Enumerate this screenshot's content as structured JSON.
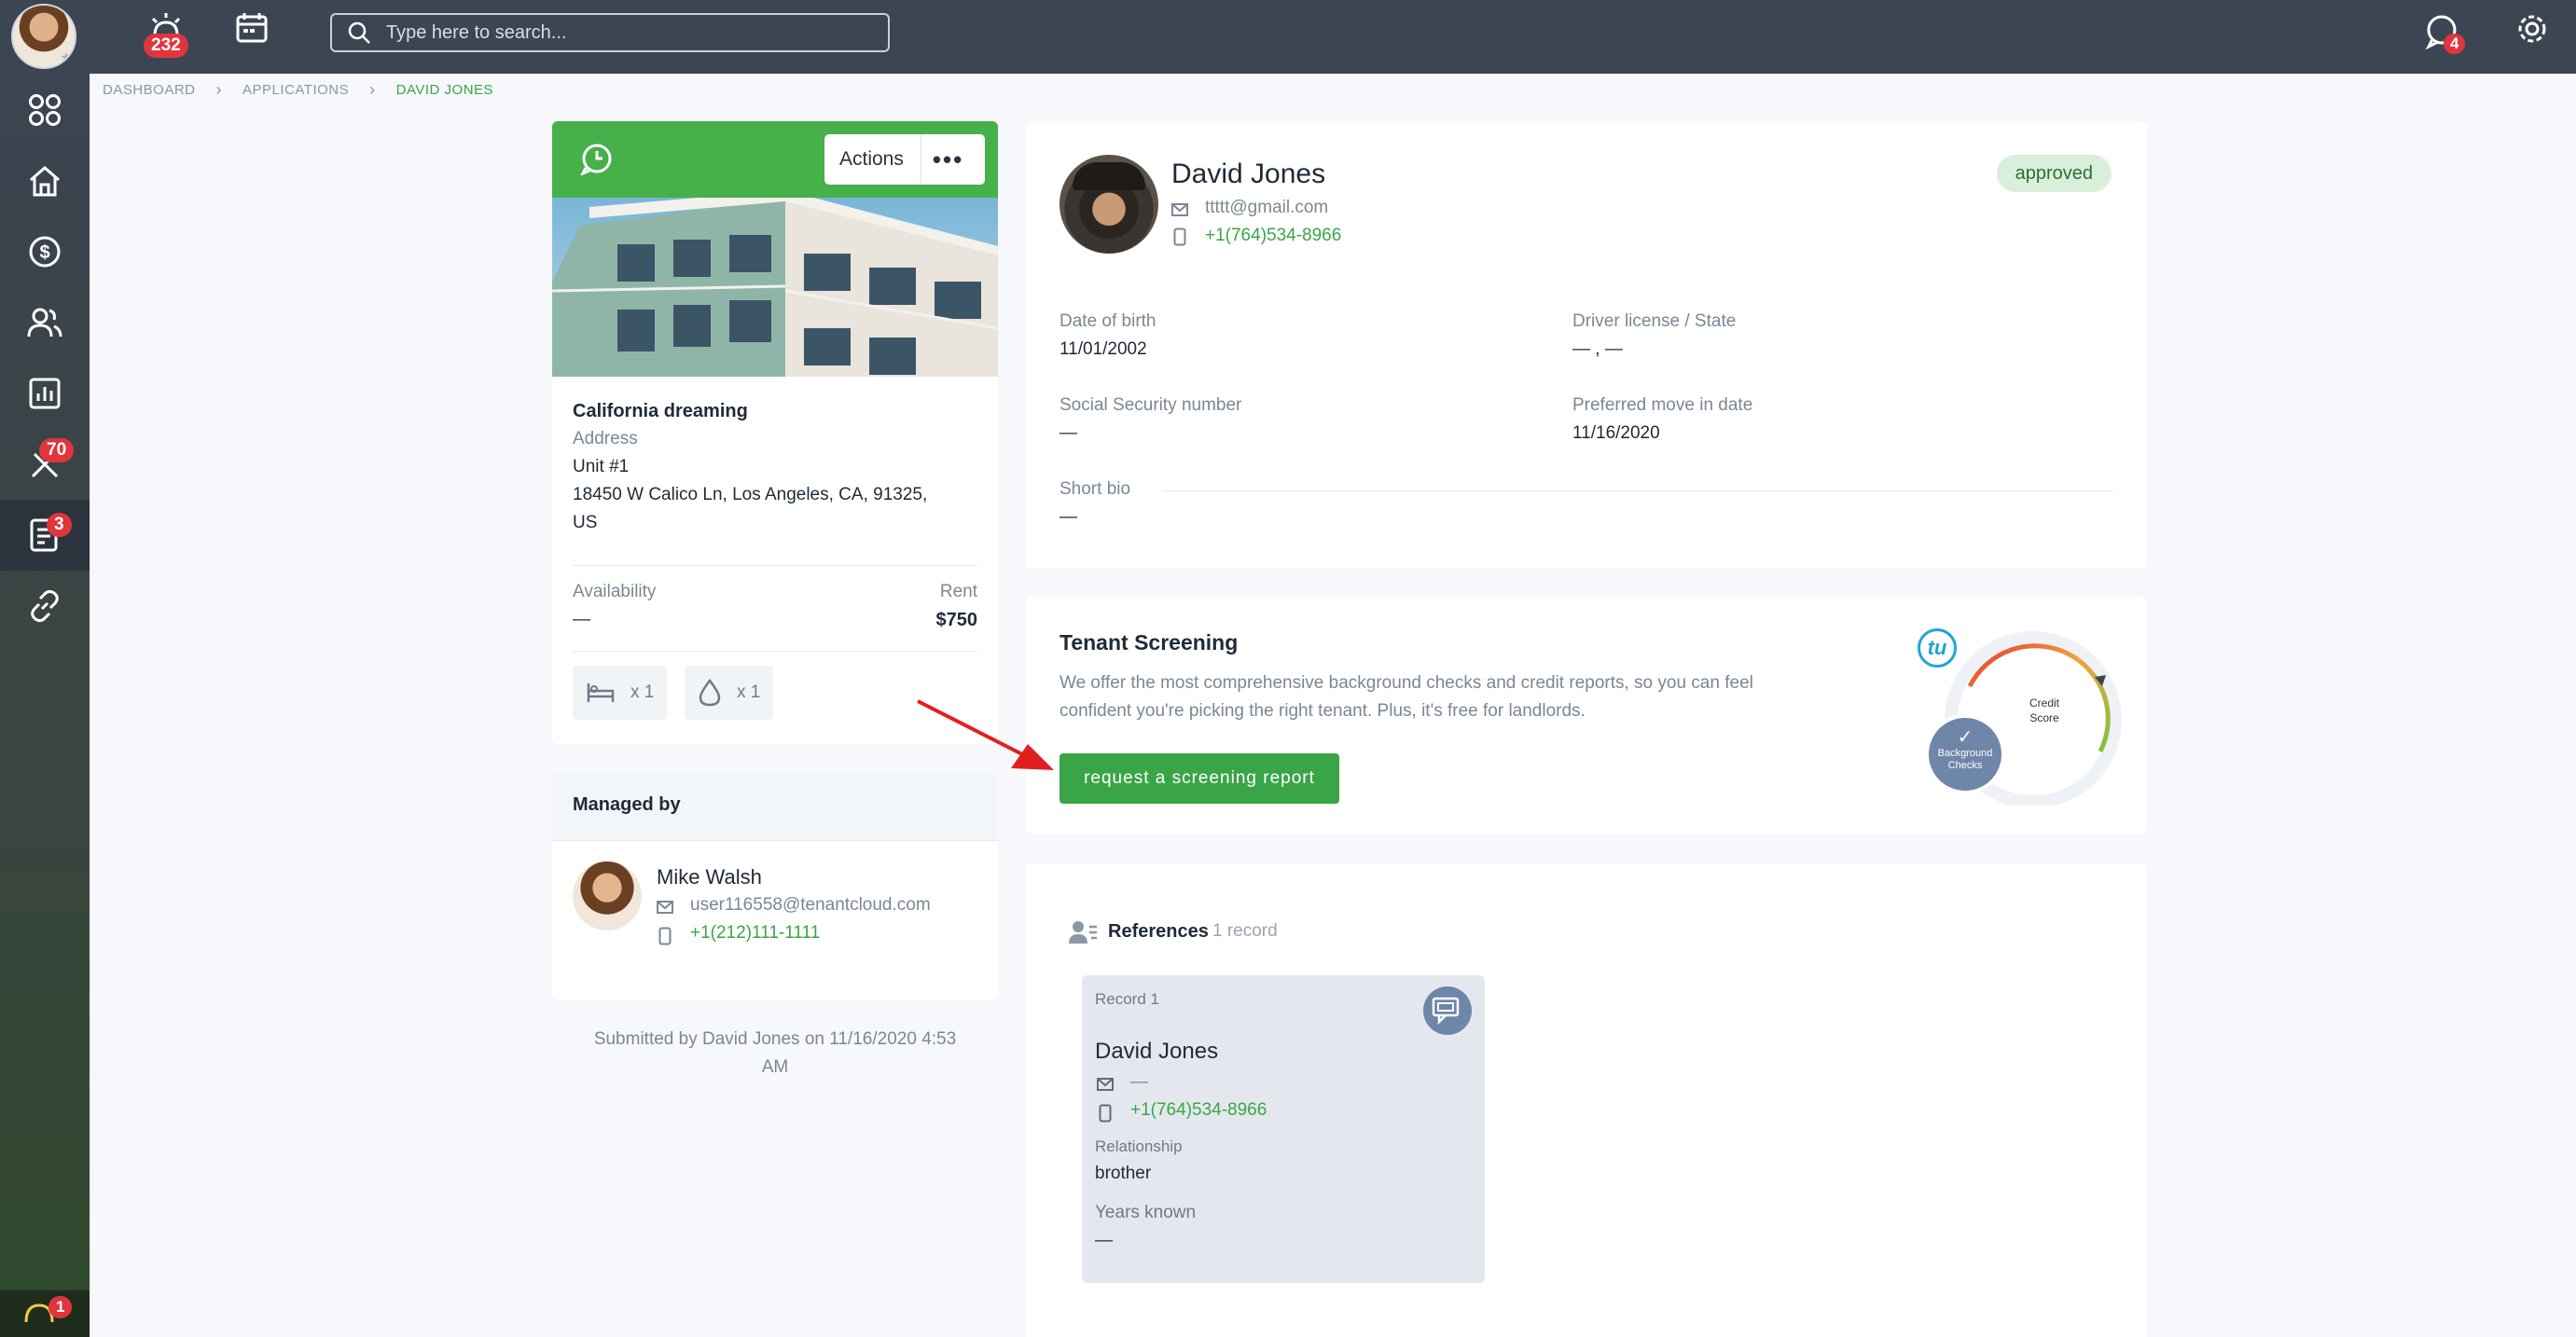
{
  "topbar": {
    "notifications_count": "232",
    "search_placeholder": "Type here to search...",
    "messages_count": "4"
  },
  "sidebar": {
    "items": [
      {
        "name": "dashboard",
        "icon": "grid-icon"
      },
      {
        "name": "home",
        "icon": "home-icon"
      },
      {
        "name": "money",
        "icon": "dollar-icon"
      },
      {
        "name": "people",
        "icon": "users-icon"
      },
      {
        "name": "reports",
        "icon": "chart-icon"
      },
      {
        "name": "maintenance",
        "icon": "tools-icon",
        "badge": "70"
      },
      {
        "name": "applications",
        "icon": "document-icon",
        "badge": "3"
      },
      {
        "name": "links",
        "icon": "link-icon"
      }
    ],
    "support_badge": "1"
  },
  "breadcrumb": {
    "items": [
      "DASHBOARD",
      "APPLICATIONS",
      "DAVID JONES"
    ]
  },
  "property": {
    "actions_label": "Actions",
    "name": "California dreaming",
    "address_label": "Address",
    "unit": "Unit #1",
    "address_line1": "18450 W Calico Ln, Los Angeles, CA, 91325,",
    "address_line2": "US",
    "availability_label": "Availability",
    "availability_value": "—",
    "rent_label": "Rent",
    "rent_value": "$750",
    "beds": "x 1",
    "baths": "x 1"
  },
  "managed_by": {
    "title": "Managed by",
    "name": "Mike Walsh",
    "email": "user116558@tenantcloud.com",
    "phone": "+1(212)111-1111"
  },
  "submitted": {
    "line1": "Submitted by David Jones on 11/16/2020 4:53",
    "line2": "AM"
  },
  "applicant": {
    "name": "David Jones",
    "email": "ttttt@gmail.com",
    "phone": "+1(764)534-8966",
    "status": "approved",
    "dob_label": "Date of birth",
    "dob_value": "11/01/2002",
    "license_label": "Driver license / State",
    "license_value": "— , —",
    "ssn_label": "Social Security number",
    "ssn_value": "—",
    "move_label": "Preferred move in date",
    "move_value": "11/16/2020",
    "bio_label": "Short bio",
    "bio_value": "—"
  },
  "screening": {
    "title": "Tenant Screening",
    "desc_line1": "We offer the most comprehensive background checks and credit reports, so you can feel",
    "desc_line2": "confident you're picking the right tenant. Plus, it's free for landlords.",
    "button_label": "request a screening report",
    "logo_text": "tu",
    "credit_line1": "Credit",
    "credit_line2": "Score",
    "bg_line1": "Background",
    "bg_line2": "Checks"
  },
  "references": {
    "title": "References",
    "count": "1 record",
    "record": {
      "label": "Record 1",
      "name": "David Jones",
      "email": "—",
      "phone": "+1(764)534-8966",
      "relationship_label": "Relationship",
      "relationship_value": "brother",
      "years_label": "Years known",
      "years_value": "—"
    }
  },
  "colors": {
    "topbar": "#3c4653",
    "accent_green": "#3aa546",
    "badge_red": "#e0353d",
    "approved_bg": "#d8efdb"
  }
}
